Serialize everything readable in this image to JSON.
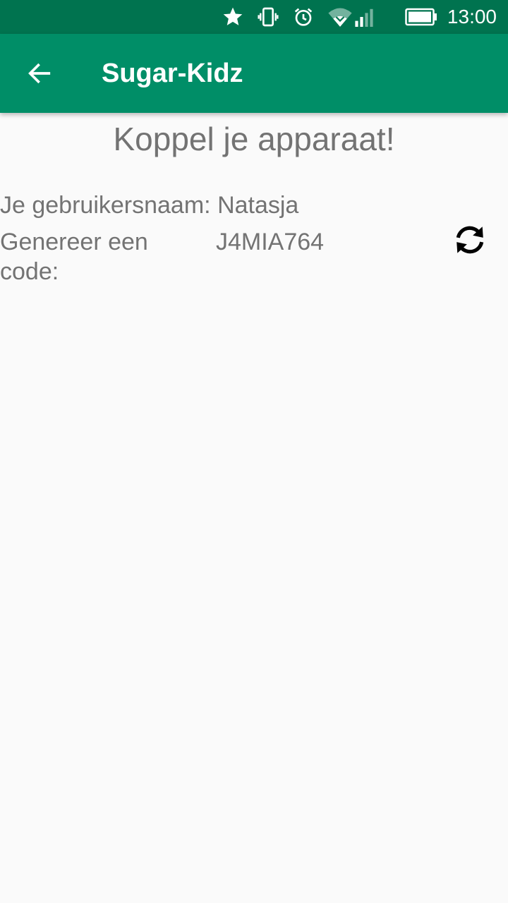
{
  "status_bar": {
    "time": "13:00",
    "icons": [
      "star-icon",
      "vibrate-icon",
      "alarm-icon",
      "wifi-icon",
      "signal-icon",
      "battery-icon"
    ]
  },
  "app_bar": {
    "title": "Sugar-Kidz",
    "back_icon": "arrow-back-icon",
    "color": "#008e67"
  },
  "main": {
    "heading": "Koppel je apparaat!",
    "username_label": "Je gebruikersnaam:",
    "username_value": "Natasja",
    "code_label": "Genereer een code:",
    "code_value": "J4MIA764",
    "refresh_icon": "refresh-icon"
  }
}
